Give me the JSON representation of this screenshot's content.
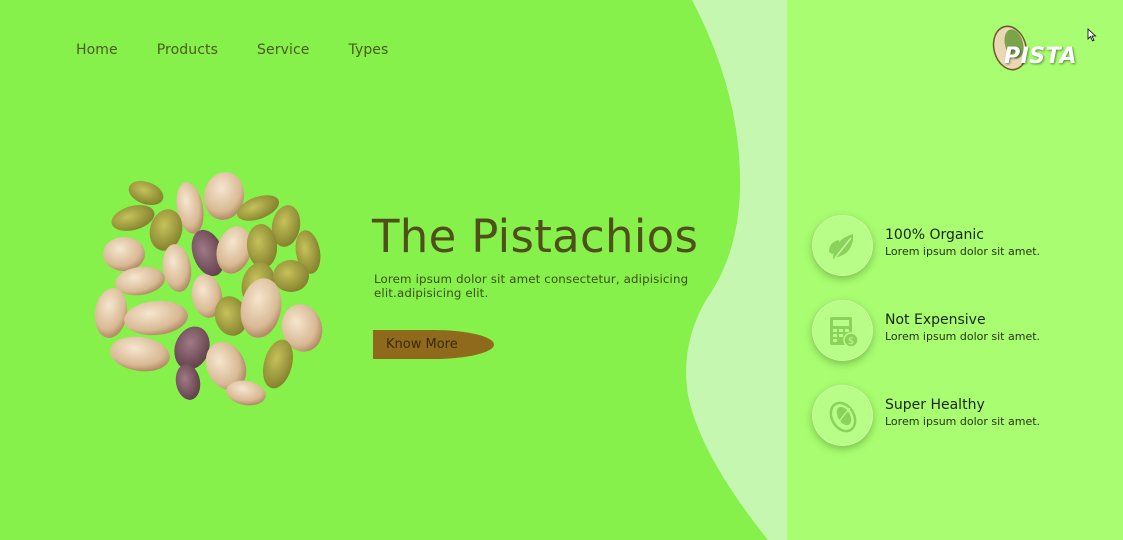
{
  "nav": {
    "items": [
      {
        "label": "Home"
      },
      {
        "label": "Products"
      },
      {
        "label": "Service"
      },
      {
        "label": "Types"
      }
    ]
  },
  "logo": {
    "text": "PISTA"
  },
  "hero": {
    "title": "The Pistachios",
    "description": "Lorem ipsum dolor sit amet consectetur, adipisicing elit.adipisicing elit.",
    "button_label": "Know More"
  },
  "features": [
    {
      "icon": "leaf-icon",
      "title": "100% Organic",
      "desc": "Lorem ipsum dolor sit amet."
    },
    {
      "icon": "calculator-dollar-icon",
      "title": "Not Expensive",
      "desc": "Lorem ipsum dolor sit amet."
    },
    {
      "icon": "pistachio-icon",
      "title": "Super Healthy",
      "desc": "Lorem ipsum dolor sit amet."
    }
  ],
  "colors": {
    "main_bg": "#86f14b",
    "side_bg": "#a8fd70",
    "wave": "#c6f7b0",
    "button": "#8f6a1c",
    "title_text": "#4f4f1c"
  }
}
